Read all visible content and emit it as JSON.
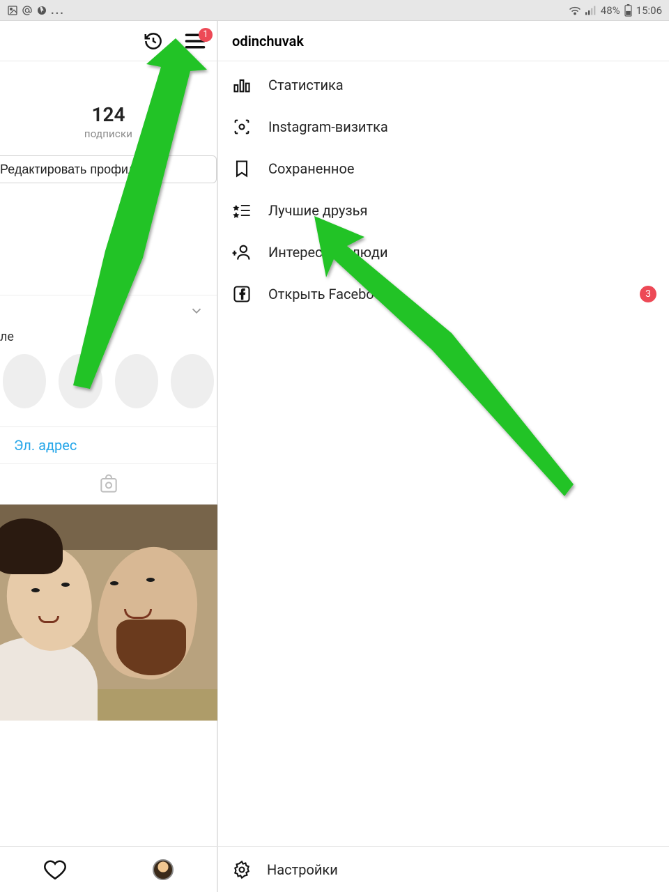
{
  "statusbar": {
    "battery_pct": "48%",
    "time": "15:06",
    "dots": "..."
  },
  "topbar": {
    "menu_badge": "1"
  },
  "profile": {
    "stat_number": "124",
    "stat_label": "подписки",
    "edit_button": "Редактировать профиль",
    "highlights_hint": "ле",
    "email_tab": "Эл. адрес"
  },
  "drawer": {
    "title": "odinchuvak",
    "items": [
      {
        "label": "Статистика"
      },
      {
        "label": "Instagram-визитка"
      },
      {
        "label": "Сохраненное"
      },
      {
        "label": "Лучшие друзья"
      },
      {
        "label": "Интересные люди"
      },
      {
        "label": "Открыть Facebook",
        "badge": "3"
      }
    ],
    "footer": "Настройки"
  }
}
